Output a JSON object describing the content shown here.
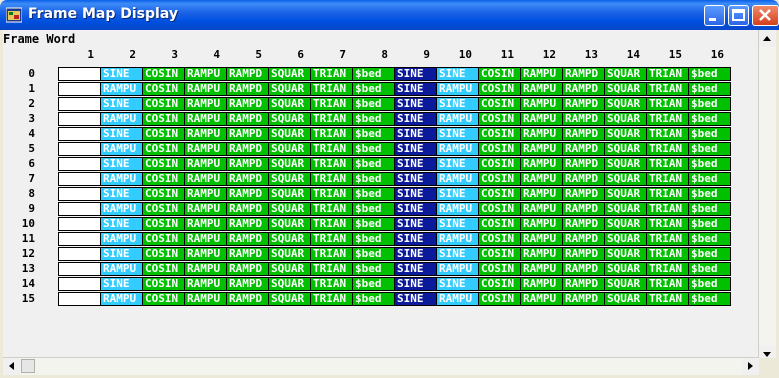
{
  "window": {
    "title": "Frame Map Display",
    "icon": "app-window-icon"
  },
  "header": {
    "label": "Frame  Word"
  },
  "columns": [
    "1",
    "2",
    "3",
    "4",
    "5",
    "6",
    "7",
    "8",
    "9",
    "10",
    "11",
    "12",
    "13",
    "14",
    "15",
    "16"
  ],
  "rows": [
    "0",
    "1",
    "2",
    "3",
    "4",
    "5",
    "6",
    "7",
    "8",
    "9",
    "10",
    "11",
    "12",
    "13",
    "14",
    "15"
  ],
  "colors": {
    "white": "#ffffff",
    "cyan": "#33ccff",
    "green": "#00c000",
    "navy": "#0a1a9a"
  },
  "grid": {
    "even_row": [
      {
        "text": "",
        "color": "white"
      },
      {
        "text": "SINE",
        "color": "cyan"
      },
      {
        "text": "COSIN",
        "color": "green"
      },
      {
        "text": "RAMPU",
        "color": "green"
      },
      {
        "text": "RAMPD",
        "color": "green"
      },
      {
        "text": "SQUAR",
        "color": "green"
      },
      {
        "text": "TRIAN",
        "color": "green"
      },
      {
        "text": "$bed",
        "color": "green"
      },
      {
        "text": "SINE",
        "color": "navy"
      },
      {
        "text": "SINE",
        "color": "cyan"
      },
      {
        "text": "COSIN",
        "color": "green"
      },
      {
        "text": "RAMPU",
        "color": "green"
      },
      {
        "text": "RAMPD",
        "color": "green"
      },
      {
        "text": "SQUAR",
        "color": "green"
      },
      {
        "text": "TRIAN",
        "color": "green"
      },
      {
        "text": "$bed",
        "color": "green"
      }
    ],
    "odd_row": [
      {
        "text": "",
        "color": "white"
      },
      {
        "text": "RAMPU",
        "color": "cyan"
      },
      {
        "text": "COSIN",
        "color": "green"
      },
      {
        "text": "RAMPU",
        "color": "green"
      },
      {
        "text": "RAMPD",
        "color": "green"
      },
      {
        "text": "SQUAR",
        "color": "green"
      },
      {
        "text": "TRIAN",
        "color": "green"
      },
      {
        "text": "$bed",
        "color": "green"
      },
      {
        "text": "SINE",
        "color": "navy"
      },
      {
        "text": "RAMPU",
        "color": "cyan"
      },
      {
        "text": "COSIN",
        "color": "green"
      },
      {
        "text": "RAMPU",
        "color": "green"
      },
      {
        "text": "RAMPD",
        "color": "green"
      },
      {
        "text": "SQUAR",
        "color": "green"
      },
      {
        "text": "TRIAN",
        "color": "green"
      },
      {
        "text": "$bed",
        "color": "green"
      }
    ]
  }
}
